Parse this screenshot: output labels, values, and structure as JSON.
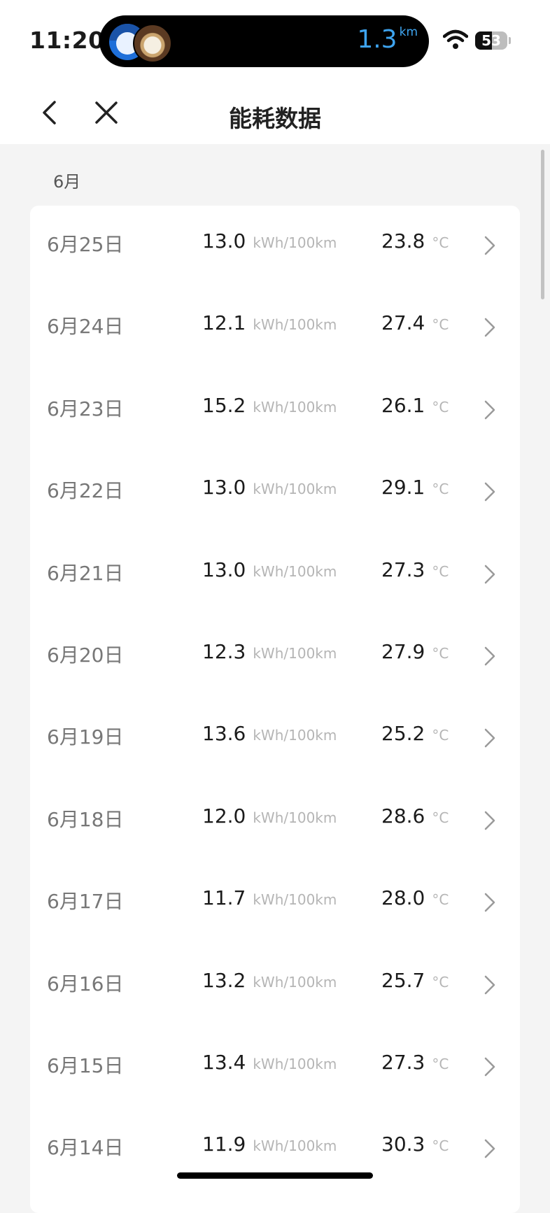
{
  "status_bar": {
    "time": "11:20",
    "island_distance": "1.3",
    "island_distance_unit": "km",
    "battery_level": "53",
    "battery_fill_percent": 53
  },
  "nav": {
    "back_icon": "chevron-left-icon",
    "close_icon": "close-icon",
    "title": "能耗数据"
  },
  "section": {
    "month": "6月"
  },
  "energy_unit": "kWh/100km",
  "temp_unit": "°C",
  "rows": [
    {
      "date": "6月25日",
      "energy": "13.0",
      "temp": "23.8"
    },
    {
      "date": "6月24日",
      "energy": "12.1",
      "temp": "27.4"
    },
    {
      "date": "6月23日",
      "energy": "15.2",
      "temp": "26.1"
    },
    {
      "date": "6月22日",
      "energy": "13.0",
      "temp": "29.1"
    },
    {
      "date": "6月21日",
      "energy": "13.0",
      "temp": "27.3"
    },
    {
      "date": "6月20日",
      "energy": "12.3",
      "temp": "27.9"
    },
    {
      "date": "6月19日",
      "energy": "13.6",
      "temp": "25.2"
    },
    {
      "date": "6月18日",
      "energy": "12.0",
      "temp": "28.6"
    },
    {
      "date": "6月17日",
      "energy": "11.7",
      "temp": "28.0"
    },
    {
      "date": "6月16日",
      "energy": "13.2",
      "temp": "25.7"
    },
    {
      "date": "6月15日",
      "energy": "13.4",
      "temp": "27.3"
    },
    {
      "date": "6月14日",
      "energy": "11.9",
      "temp": "30.3"
    }
  ],
  "colors": {
    "accent_distance": "#3ea4ef",
    "page_background": "#f4f4f4",
    "unit_gray": "#b5b5b5"
  }
}
